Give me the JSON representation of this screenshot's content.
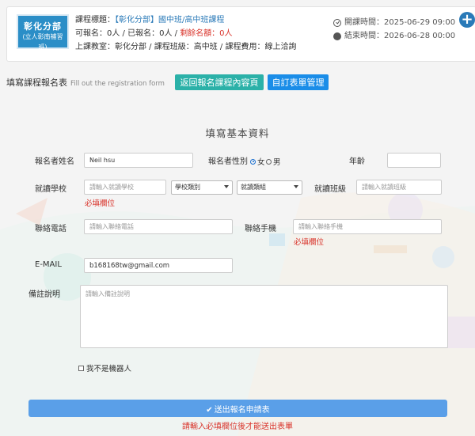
{
  "course": {
    "logo_line1": "彰化分部",
    "logo_line2": "(立人彰南補習班)",
    "title_label": "課程標題：",
    "title": "【彰化分部】國中班/高中班課程",
    "enroll_text": "可報名：0人 / 已報名：0人 /",
    "remaining": "剩餘名額：0人",
    "venue_text": "上課教室：彰化分部 / 課程班級：高中班 / 課程費用：線上洽詢",
    "start_time": "開課時間：2025-06-29 09:00",
    "end_time": "結束時間：2026-06-28 00:00",
    "plus_symbol": "+"
  },
  "heading": {
    "title": "填寫課程報名表",
    "subtitle": "Fill out the registration form",
    "back_button": "返回報名課程內容頁",
    "manage_button": "自訂表單管理"
  },
  "form": {
    "section_title": "填寫基本資料",
    "name_label": "報名者姓名",
    "name_value": "Neil hsu",
    "gender_label": "報名者性別",
    "gender_female": "女",
    "gender_male": "男",
    "age_label": "年齡",
    "age_value": "",
    "school_label": "就讀學校",
    "school_placeholder": "請輸入就讀學校",
    "school_type": "學校類別",
    "school_group": "就讀類組",
    "school_required": "必填欄位",
    "class_label": "就讀班級",
    "class_placeholder": "請輸入就讀班級",
    "phone_label": "聯絡電話",
    "phone_placeholder": "請輸入聯絡電話",
    "mobile_label": "聯絡手機",
    "mobile_placeholder": "請輸入聯絡手機",
    "mobile_required": "必填欄位",
    "email_label": "E-MAIL",
    "email_value": "b168168tw@gmail.com",
    "note_label": "備註說明",
    "note_placeholder": "請輸入備註說明",
    "robot_label": "我不是機器人",
    "submit_label": "送出報名申請表",
    "submit_warning": "請輸入必填欄位後才能送出表單"
  },
  "colors": {
    "teal_button": "#2bb1a8",
    "blue_button": "#1a8de8",
    "submit_button": "#5a9fe8",
    "required_red": "#d9342b",
    "link_blue": "#2a7ab8"
  }
}
